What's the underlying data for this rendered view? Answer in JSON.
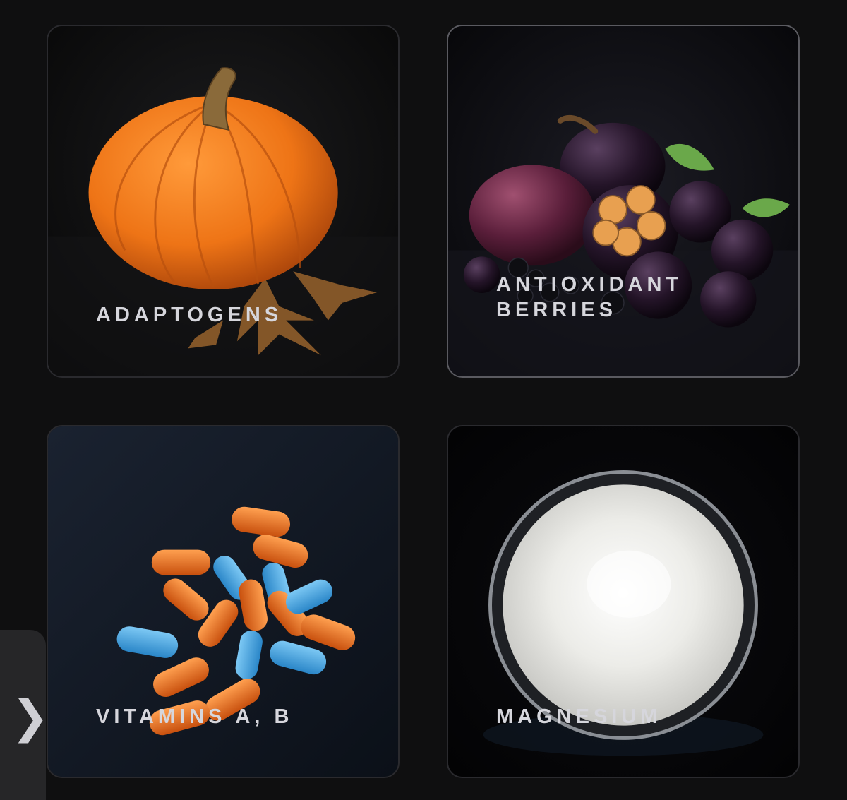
{
  "cards": [
    {
      "label_lines": [
        "ADAPTOGENS"
      ],
      "image": "pumpkin-image"
    },
    {
      "label_lines": [
        "ANTIOXIDANT",
        "BERRIES"
      ],
      "image": "berries-image"
    },
    {
      "label_lines": [
        "VITAMINS A, B"
      ],
      "image": "capsules-image"
    },
    {
      "label_lines": [
        "MAGNESIUM"
      ],
      "image": "powder-image"
    }
  ],
  "side_tab": {
    "glyph": "❯",
    "icon": "chevron-right-icon"
  },
  "colors": {
    "background": "#0f0f10",
    "card_border": "#2a2a2e",
    "label_text": "#d6d6dc",
    "pumpkin": "#f07a1a",
    "berry": "#3a1530",
    "capsule_orange": "#e8621c",
    "capsule_blue": "#3aa6e8",
    "powder": "#eeeeea"
  }
}
